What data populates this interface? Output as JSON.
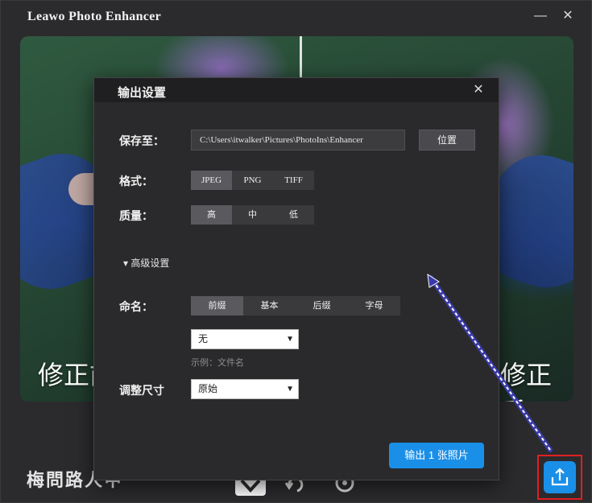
{
  "app": {
    "title": "Leawo Photo Enhancer",
    "minimize_icon": "minimize-icon",
    "close_icon": "close-icon"
  },
  "preview": {
    "before_label": "修正前",
    "after_label": "修正后"
  },
  "dialog": {
    "title": "输出设置",
    "save_to_label": "保存至：",
    "save_path": "C:\\Users\\itwalker\\Pictures\\PhotoIns\\Enhancer",
    "location_button": "位置",
    "format_label": "格式：",
    "formats": [
      "JPEG",
      "PNG",
      "TIFF"
    ],
    "format_selected": "JPEG",
    "quality_label": "质量：",
    "qualities": [
      "高",
      "中",
      "低"
    ],
    "quality_selected": "高",
    "advanced_label": "高级设置",
    "naming_label": "命名：",
    "naming_options": [
      "前缀",
      "基本",
      "后缀",
      "字母"
    ],
    "naming_selected": "前缀",
    "naming_select_value": "无",
    "example_text": "示例：文件名",
    "resize_label": "调整尺寸",
    "resize_value": "原始",
    "export_button": "输出 1 张照片"
  },
  "bottom": {
    "watermark": "梅問路人甲",
    "icons": [
      "compare-icon",
      "rotate-icon",
      "help-icon",
      "export-icon"
    ]
  },
  "colors": {
    "accent": "#1a8fe8",
    "highlight_box": "#e02020",
    "annotation_arrow": "#3a3aa8"
  }
}
